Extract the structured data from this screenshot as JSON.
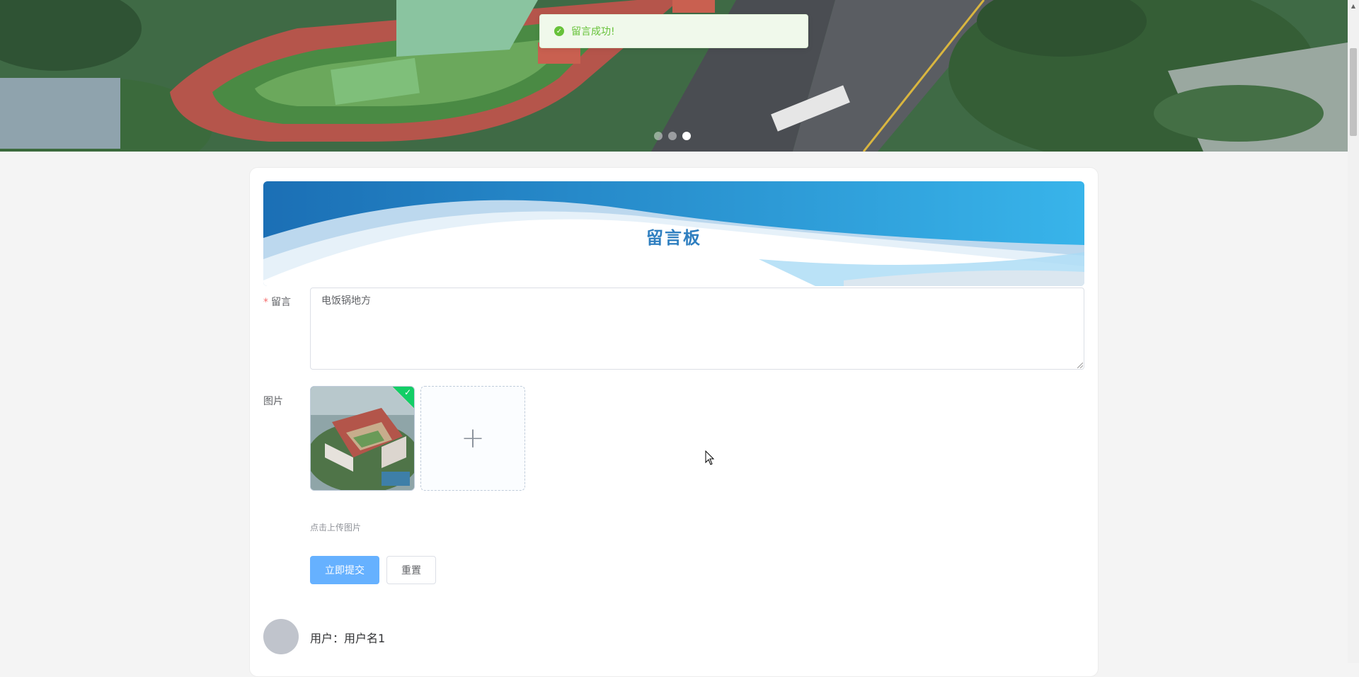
{
  "toast": {
    "icon": "check-circle-icon",
    "text": "留言成功!"
  },
  "carousel": {
    "slide_count": 3,
    "active_index": 2
  },
  "board": {
    "title": "留言板",
    "message_label": "留言",
    "required_mark": "*",
    "message_value": "电饭锅地方",
    "image_label": "图片",
    "upload_tip": "点击上传图片",
    "submit_label": "立即提交",
    "reset_label": "重置"
  },
  "comment": {
    "user_text": "用户：用户名1"
  },
  "colors": {
    "primary": "#66b1ff",
    "success": "#67c23a",
    "title": "#2f7fc0",
    "upload_ok": "#13ce66"
  }
}
